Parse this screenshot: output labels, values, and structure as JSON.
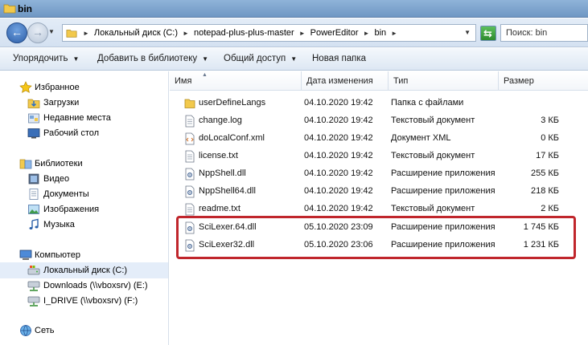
{
  "window": {
    "title": "bin"
  },
  "address": {
    "crumbs": [
      "Локальный диск (C:)",
      "notepad-plus-plus-master",
      "PowerEditor",
      "bin"
    ],
    "search_placeholder": "Поиск: bin"
  },
  "toolbar": {
    "organize": "Упорядочить",
    "add_library": "Добавить в библиотеку",
    "share": "Общий доступ",
    "new_folder": "Новая папка"
  },
  "nav": {
    "favorites": "Избранное",
    "downloads": "Загрузки",
    "recent": "Недавние места",
    "desktop": "Рабочий стол",
    "libraries": "Библиотеки",
    "video": "Видео",
    "documents": "Документы",
    "images": "Изображения",
    "music": "Музыка",
    "computer": "Компьютер",
    "local_disk": "Локальный диск (C:)",
    "downloads_share": "Downloads (\\\\vboxsrv) (E:)",
    "idrive": "I_DRIVE (\\\\vboxsrv) (F:)",
    "network": "Сеть"
  },
  "columns": {
    "name": "Имя",
    "date": "Дата изменения",
    "type": "Тип",
    "size": "Размер"
  },
  "files": [
    {
      "name": "userDefineLangs",
      "date": "04.10.2020 19:42",
      "type": "Папка с файлами",
      "size": "",
      "kind": "folder"
    },
    {
      "name": "change.log",
      "date": "04.10.2020 19:42",
      "type": "Текстовый документ",
      "size": "3 КБ",
      "kind": "text"
    },
    {
      "name": "doLocalConf.xml",
      "date": "04.10.2020 19:42",
      "type": "Документ XML",
      "size": "0 КБ",
      "kind": "xml"
    },
    {
      "name": "license.txt",
      "date": "04.10.2020 19:42",
      "type": "Текстовый документ",
      "size": "17 КБ",
      "kind": "text"
    },
    {
      "name": "NppShell.dll",
      "date": "04.10.2020 19:42",
      "type": "Расширение приложения",
      "size": "255 КБ",
      "kind": "dll"
    },
    {
      "name": "NppShell64.dll",
      "date": "04.10.2020 19:42",
      "type": "Расширение приложения",
      "size": "218 КБ",
      "kind": "dll"
    },
    {
      "name": "readme.txt",
      "date": "04.10.2020 19:42",
      "type": "Текстовый документ",
      "size": "2 КБ",
      "kind": "text"
    },
    {
      "name": "SciLexer.64.dll",
      "date": "05.10.2020 23:09",
      "type": "Расширение приложения",
      "size": "1 745 КБ",
      "kind": "dll"
    },
    {
      "name": "SciLexer32.dll",
      "date": "05.10.2020 23:06",
      "type": "Расширение приложения",
      "size": "1 231 КБ",
      "kind": "dll"
    }
  ],
  "colors": {
    "highlight": "#c0262c",
    "selection": "#e4edf9",
    "title_bar": "#7ea4cf"
  }
}
